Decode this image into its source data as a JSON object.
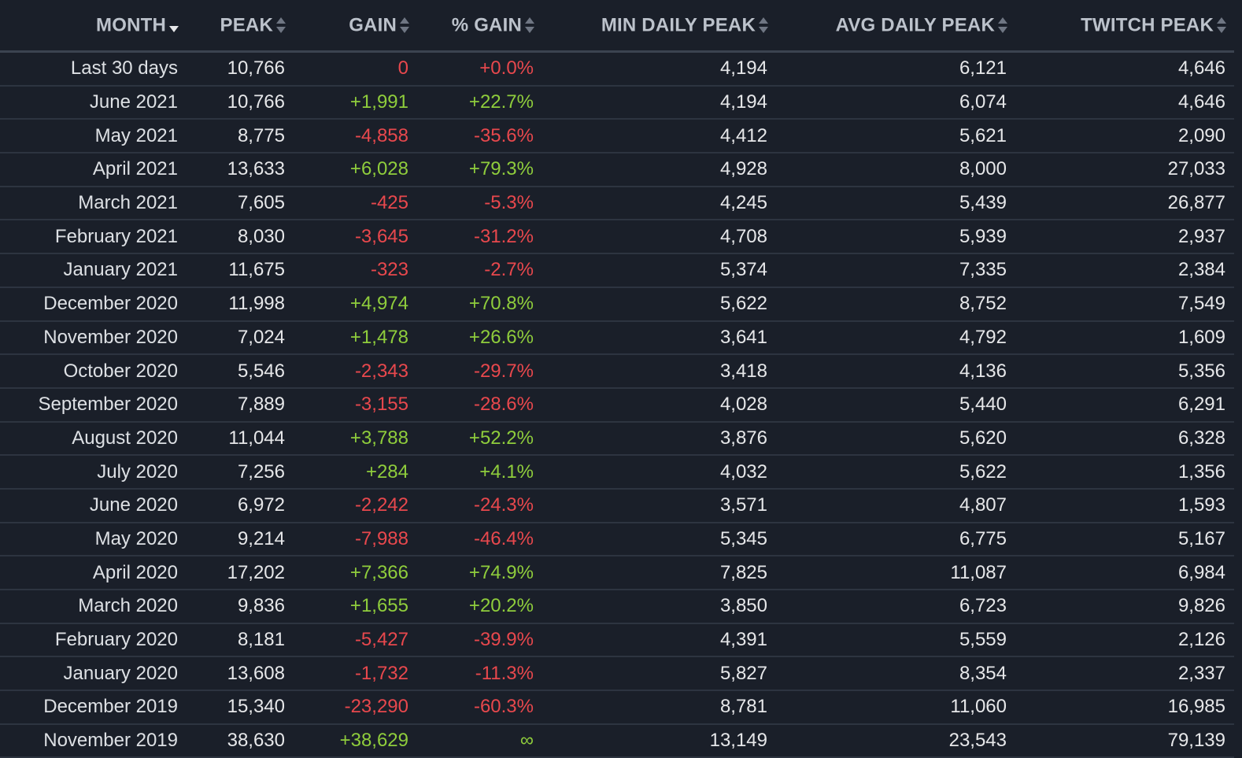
{
  "headers": {
    "month": "MONTH",
    "peak": "PEAK",
    "gain": "GAIN",
    "pct_gain": "% GAIN",
    "min_daily_peak": "MIN DAILY PEAK",
    "avg_daily_peak": "AVG DAILY PEAK",
    "twitch_peak": "TWITCH PEAK"
  },
  "sort": {
    "column": "month",
    "direction": "descending",
    "icon": "sort-desc-arrow"
  },
  "colors": {
    "background": "#1a1f29",
    "positive": "#8fcd3c",
    "negative": "#e8484d",
    "text": "#e6e7e9",
    "header_text": "#bcc2cb"
  },
  "rows": [
    {
      "month": "Last 30 days",
      "peak": "10,766",
      "gain": "0",
      "pct": "+0.0%",
      "min": "4,194",
      "avg": "6,121",
      "twitch": "4,646",
      "trend": "neg"
    },
    {
      "month": "June 2021",
      "peak": "10,766",
      "gain": "+1,991",
      "pct": "+22.7%",
      "min": "4,194",
      "avg": "6,074",
      "twitch": "4,646",
      "trend": "pos"
    },
    {
      "month": "May 2021",
      "peak": "8,775",
      "gain": "-4,858",
      "pct": "-35.6%",
      "min": "4,412",
      "avg": "5,621",
      "twitch": "2,090",
      "trend": "neg"
    },
    {
      "month": "April 2021",
      "peak": "13,633",
      "gain": "+6,028",
      "pct": "+79.3%",
      "min": "4,928",
      "avg": "8,000",
      "twitch": "27,033",
      "trend": "pos"
    },
    {
      "month": "March 2021",
      "peak": "7,605",
      "gain": "-425",
      "pct": "-5.3%",
      "min": "4,245",
      "avg": "5,439",
      "twitch": "26,877",
      "trend": "neg"
    },
    {
      "month": "February 2021",
      "peak": "8,030",
      "gain": "-3,645",
      "pct": "-31.2%",
      "min": "4,708",
      "avg": "5,939",
      "twitch": "2,937",
      "trend": "neg"
    },
    {
      "month": "January 2021",
      "peak": "11,675",
      "gain": "-323",
      "pct": "-2.7%",
      "min": "5,374",
      "avg": "7,335",
      "twitch": "2,384",
      "trend": "neg"
    },
    {
      "month": "December 2020",
      "peak": "11,998",
      "gain": "+4,974",
      "pct": "+70.8%",
      "min": "5,622",
      "avg": "8,752",
      "twitch": "7,549",
      "trend": "pos"
    },
    {
      "month": "November 2020",
      "peak": "7,024",
      "gain": "+1,478",
      "pct": "+26.6%",
      "min": "3,641",
      "avg": "4,792",
      "twitch": "1,609",
      "trend": "pos"
    },
    {
      "month": "October 2020",
      "peak": "5,546",
      "gain": "-2,343",
      "pct": "-29.7%",
      "min": "3,418",
      "avg": "4,136",
      "twitch": "5,356",
      "trend": "neg"
    },
    {
      "month": "September 2020",
      "peak": "7,889",
      "gain": "-3,155",
      "pct": "-28.6%",
      "min": "4,028",
      "avg": "5,440",
      "twitch": "6,291",
      "trend": "neg"
    },
    {
      "month": "August 2020",
      "peak": "11,044",
      "gain": "+3,788",
      "pct": "+52.2%",
      "min": "3,876",
      "avg": "5,620",
      "twitch": "6,328",
      "trend": "pos"
    },
    {
      "month": "July 2020",
      "peak": "7,256",
      "gain": "+284",
      "pct": "+4.1%",
      "min": "4,032",
      "avg": "5,622",
      "twitch": "1,356",
      "trend": "pos"
    },
    {
      "month": "June 2020",
      "peak": "6,972",
      "gain": "-2,242",
      "pct": "-24.3%",
      "min": "3,571",
      "avg": "4,807",
      "twitch": "1,593",
      "trend": "neg"
    },
    {
      "month": "May 2020",
      "peak": "9,214",
      "gain": "-7,988",
      "pct": "-46.4%",
      "min": "5,345",
      "avg": "6,775",
      "twitch": "5,167",
      "trend": "neg"
    },
    {
      "month": "April 2020",
      "peak": "17,202",
      "gain": "+7,366",
      "pct": "+74.9%",
      "min": "7,825",
      "avg": "11,087",
      "twitch": "6,984",
      "trend": "pos"
    },
    {
      "month": "March 2020",
      "peak": "9,836",
      "gain": "+1,655",
      "pct": "+20.2%",
      "min": "3,850",
      "avg": "6,723",
      "twitch": "9,826",
      "trend": "pos"
    },
    {
      "month": "February 2020",
      "peak": "8,181",
      "gain": "-5,427",
      "pct": "-39.9%",
      "min": "4,391",
      "avg": "5,559",
      "twitch": "2,126",
      "trend": "neg"
    },
    {
      "month": "January 2020",
      "peak": "13,608",
      "gain": "-1,732",
      "pct": "-11.3%",
      "min": "5,827",
      "avg": "8,354",
      "twitch": "2,337",
      "trend": "neg"
    },
    {
      "month": "December 2019",
      "peak": "15,340",
      "gain": "-23,290",
      "pct": "-60.3%",
      "min": "8,781",
      "avg": "11,060",
      "twitch": "16,985",
      "trend": "neg"
    },
    {
      "month": "November 2019",
      "peak": "38,630",
      "gain": "+38,629",
      "pct": "∞",
      "min": "13,149",
      "avg": "23,543",
      "twitch": "79,139",
      "trend": "pos"
    }
  ]
}
